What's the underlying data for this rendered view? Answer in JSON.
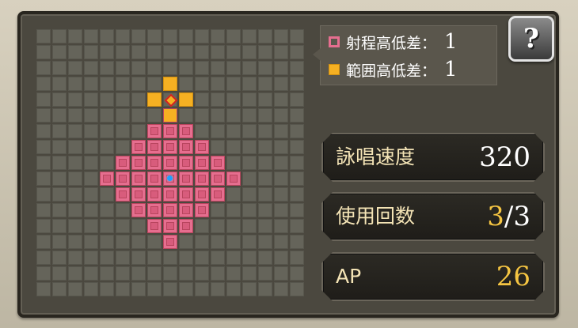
{
  "grid": {
    "columns": 17,
    "rows": 17,
    "range_cells": [
      [
        8,
        5
      ],
      [
        7,
        6
      ],
      [
        8,
        6
      ],
      [
        9,
        6
      ],
      [
        6,
        7
      ],
      [
        7,
        7
      ],
      [
        8,
        7
      ],
      [
        9,
        7
      ],
      [
        10,
        7
      ],
      [
        5,
        8
      ],
      [
        6,
        8
      ],
      [
        7,
        8
      ],
      [
        8,
        8
      ],
      [
        9,
        8
      ],
      [
        10,
        8
      ],
      [
        11,
        8
      ],
      [
        4,
        9
      ],
      [
        5,
        9
      ],
      [
        6,
        9
      ],
      [
        7,
        9
      ],
      [
        8,
        9
      ],
      [
        9,
        9
      ],
      [
        10,
        9
      ],
      [
        11,
        9
      ],
      [
        12,
        9
      ],
      [
        5,
        10
      ],
      [
        6,
        10
      ],
      [
        7,
        10
      ],
      [
        8,
        10
      ],
      [
        9,
        10
      ],
      [
        10,
        10
      ],
      [
        11,
        10
      ],
      [
        6,
        11
      ],
      [
        7,
        11
      ],
      [
        8,
        11
      ],
      [
        9,
        11
      ],
      [
        10,
        11
      ],
      [
        7,
        12
      ],
      [
        8,
        12
      ],
      [
        9,
        12
      ],
      [
        8,
        13
      ]
    ],
    "area_cells": [
      [
        8,
        3
      ],
      [
        7,
        4
      ],
      [
        9,
        4
      ],
      [
        8,
        5
      ]
    ],
    "target_cell": [
      8,
      4
    ],
    "caster_cell": [
      8,
      9
    ],
    "colors": {
      "range": "#e66e8f",
      "area": "#f5b022",
      "target_marker": "#d02020",
      "caster_marker": "#1fa0ff"
    }
  },
  "legend": {
    "range_height_label": "射程高低差：",
    "range_height_value": "1",
    "area_height_label": "範囲高低差：",
    "area_height_value": "1"
  },
  "help_button": {
    "icon": "question-book-icon",
    "glyph": "?"
  },
  "stats": {
    "cast_speed_label": "詠唱速度",
    "cast_speed_value": "320",
    "uses_label": "使用回数",
    "uses_current": "3",
    "uses_separator": "/",
    "uses_max": "3",
    "ap_label": "AP",
    "ap_value": "26"
  }
}
